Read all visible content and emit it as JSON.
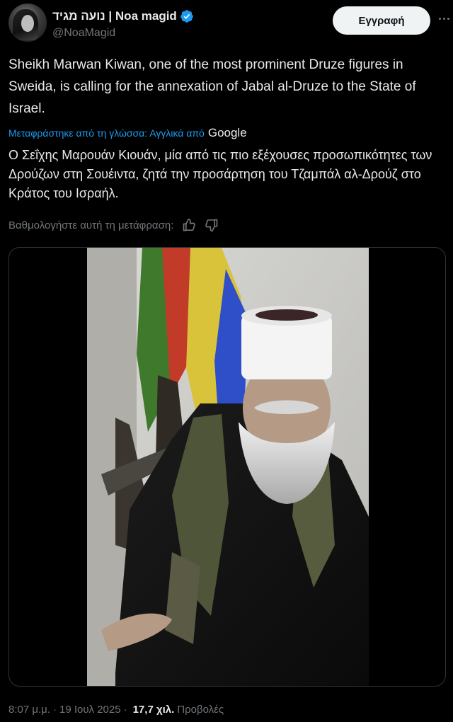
{
  "author": {
    "display_name": "נועה מגיד | Noa magid",
    "handle": "@NoaMagid",
    "verified_icon": "verified-badge-icon"
  },
  "header": {
    "subscribe_label": "Εγγραφή",
    "more_icon": "more-options-icon"
  },
  "tweet": {
    "text": "Sheikh Marwan Kiwan, one of the most prominent Druze figures in Sweida, is calling for the annexation of Jabal al-Druze to the State of Israel.",
    "translation_label": "Μεταφράστηκε από τη γλώσσα: Αγγλικά από",
    "translation_provider": "Google",
    "translated_text": "Ο Σεΐχης Μαρουάν Κιουάν, μία από τις πιο εξέχουσες προσωπικότητες των Δρούζων στη Σουέιντα, ζητά την προσάρτηση του Τζαμπάλ αλ-Δρούζ στο Κράτος του Ισραήλ.",
    "rate_label": "Βαθμολογήστε αυτή τη μετάφραση:"
  },
  "media": {
    "type": "video"
  },
  "footer": {
    "time": "8:07 μ.μ.",
    "separator": "·",
    "date": "19 Ιουλ 2025",
    "views": "17,7 χιλ.",
    "views_label": "Προβολές"
  },
  "colors": {
    "background": "#000000",
    "text": "#e7e9ea",
    "muted": "#71767b",
    "link": "#1d9bf0",
    "verified": "#1d9bf0",
    "button_bg": "#eff3f4"
  }
}
